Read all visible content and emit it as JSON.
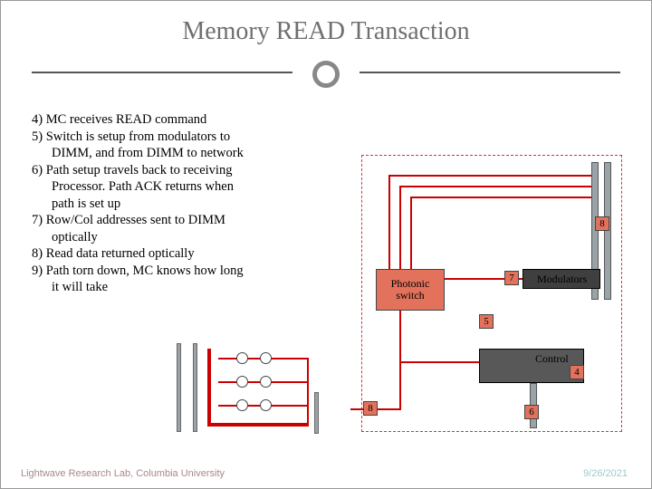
{
  "title": "Memory READ Transaction",
  "steps": {
    "s4": "4) MC receives READ command",
    "s5a": "5) Switch is setup from modulators to",
    "s5b": "DIMM, and from DIMM to network",
    "s6a": "6) Path setup travels back to receiving",
    "s6b": "Processor. Path ACK returns when",
    "s6c": "path is set up",
    "s7a": "7) Row/Col addresses sent to DIMM",
    "s7b": "optically",
    "s8": "8) Read data returned optically",
    "s9a": "9) Path torn down, MC knows how long",
    "s9b": "it will take"
  },
  "diagram": {
    "photonic_switch_l1": "Photonic",
    "photonic_switch_l2": "switch",
    "modulators": "Modulators",
    "control": "Control",
    "badges": {
      "b4": "4",
      "b5": "5",
      "b6": "6",
      "b7": "7",
      "b8a": "8",
      "b8b": "8"
    }
  },
  "footer": {
    "left": "Lightwave Research Lab, Columbia University",
    "right": "9/26/2021"
  }
}
